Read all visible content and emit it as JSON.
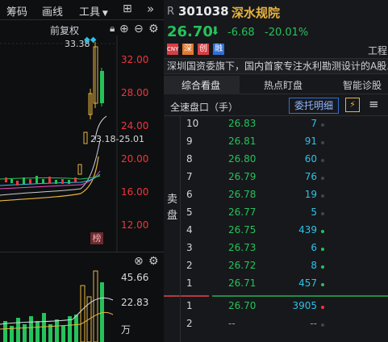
{
  "toolbar": {
    "chips": "筹码",
    "lines": "画线",
    "tools": "工具",
    "fq": "前复权"
  },
  "stock": {
    "prefix": "R",
    "code": "301038",
    "name": "深水规院",
    "price": "26.70",
    "change": "-6.68",
    "pct": "-20.01%",
    "tags": [
      "CNY",
      "深",
      "创",
      "融"
    ],
    "right_cut": "工程",
    "desc": "深圳国资委旗下，国内首家专注水利勘测设计的A股..."
  },
  "chart": {
    "y_labels": [
      "32.00",
      "28.00",
      "24.00",
      "20.00",
      "16.00",
      "12.00"
    ],
    "high_label": "33.38",
    "range_label": "23.18-25.01",
    "volume_labels": [
      "45.66",
      "22.83",
      "万"
    ],
    "rank_badge": "榜"
  },
  "tabs": [
    "综合看盘",
    "热点盯盘",
    "智能诊股"
  ],
  "orderbook": {
    "title": "全速盘口（手）",
    "button": "委托明细",
    "sell_label": [
      "卖",
      "盘"
    ],
    "sell": [
      {
        "lvl": "10",
        "price": "26.83",
        "vol": "7"
      },
      {
        "lvl": "9",
        "price": "26.81",
        "vol": "91"
      },
      {
        "lvl": "8",
        "price": "26.80",
        "vol": "60"
      },
      {
        "lvl": "7",
        "price": "26.79",
        "vol": "76"
      },
      {
        "lvl": "6",
        "price": "26.78",
        "vol": "19"
      },
      {
        "lvl": "5",
        "price": "26.77",
        "vol": "5"
      },
      {
        "lvl": "4",
        "price": "26.75",
        "vol": "439"
      },
      {
        "lvl": "3",
        "price": "26.73",
        "vol": "6"
      },
      {
        "lvl": "2",
        "price": "26.72",
        "vol": "8"
      },
      {
        "lvl": "1",
        "price": "26.71",
        "vol": "457"
      }
    ],
    "buy": [
      {
        "lvl": "1",
        "price": "26.70",
        "vol": "3905"
      },
      {
        "lvl": "2",
        "price": "--",
        "vol": "--"
      }
    ]
  },
  "colors": {
    "up": "#f0363c",
    "down": "#25c25b",
    "accent": "#e8b53e",
    "cyan": "#2ec1e6"
  }
}
